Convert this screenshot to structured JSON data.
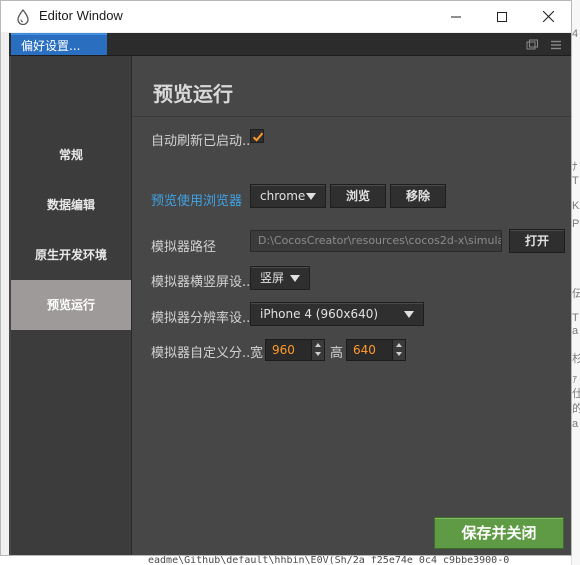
{
  "window": {
    "title": "Editor Window",
    "controls": {
      "minimize": "minimize-icon",
      "maximize": "maximize-icon",
      "close": "close-icon"
    }
  },
  "tab": {
    "label": "偏好设置..."
  },
  "sidebar": {
    "items": [
      {
        "label": "常规",
        "active": false
      },
      {
        "label": "数据编辑",
        "active": false
      },
      {
        "label": "原生开发环境",
        "active": false
      },
      {
        "label": "预览运行",
        "active": true
      }
    ]
  },
  "content": {
    "heading": "预览运行",
    "auto_refresh": {
      "label": "自动刷新已启动..",
      "checked": true
    },
    "browser": {
      "label": "预览使用浏览器",
      "selected": "chrome",
      "browse_button": "浏览",
      "remove_button": "移除"
    },
    "simulator_path": {
      "label": "模拟器路径",
      "value": "D:\\CocosCreator\\resources\\cocos2d-x\\simula",
      "open_button": "打开"
    },
    "orientation": {
      "label": "模拟器横竖屏设..",
      "selected": "竖屏"
    },
    "resolution": {
      "label": "模拟器分辨率设..",
      "selected": "iPhone 4 (960x640)"
    },
    "custom_resolution": {
      "label": "模拟器自定义分..",
      "width_label": "宽",
      "width_value": "960",
      "height_label": "高",
      "height_value": "640"
    },
    "save_button": "保存并关闭"
  },
  "background": {
    "edge_glyphs": [
      "4",
      "ﾅ",
      "T",
      "K",
      "P",
      "伝",
      "T",
      "a",
      "杉",
      "ｧ",
      "仕",
      "的",
      "a"
    ],
    "bottom_text": "eadme\\Github\\default\\hhbin\\E0V(Sh/2a f25e74e 0c4 c9bbe3900-0"
  },
  "colors": {
    "accent_tab": "#2a6ec0",
    "link": "#3fa3e6",
    "active_item": "#9e9a9a",
    "number_value": "#ff9a28",
    "save_button": "#5f9a44",
    "checkmark": "#ff9a28"
  }
}
